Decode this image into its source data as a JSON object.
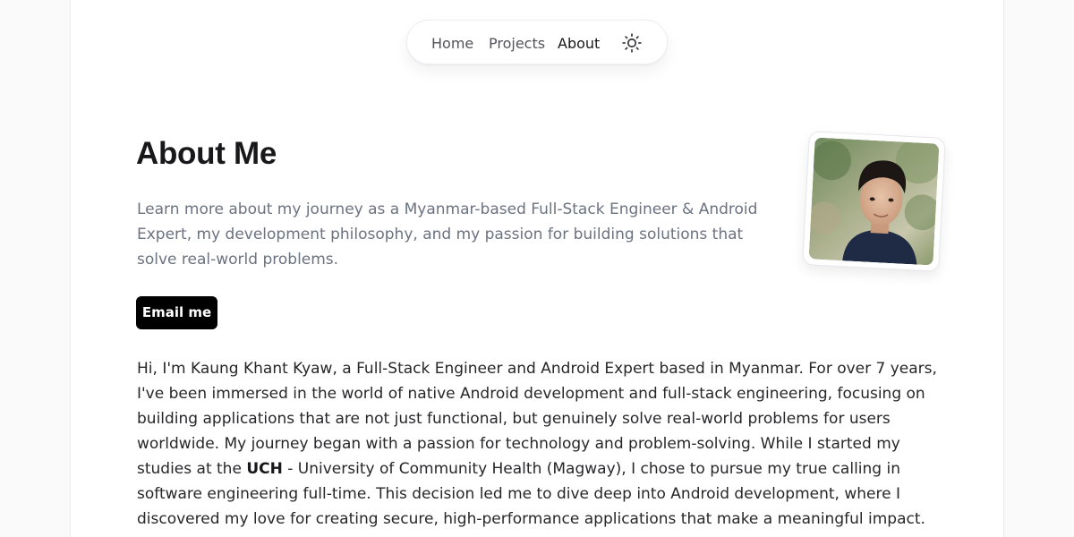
{
  "nav": {
    "links": [
      {
        "label": "Home",
        "active": false
      },
      {
        "label": "Projects",
        "active": false
      },
      {
        "label": "About",
        "active": true
      }
    ],
    "theme_toggle_icon": "sun-icon"
  },
  "hero": {
    "title": "About Me",
    "intro": "Learn more about my journey as a Myanmar-based Full-Stack Engineer & Android Expert, my development philosophy, and my passion for building solutions that solve real-world problems.",
    "email_button_label": "Email me",
    "avatar_icon": "profile-photo"
  },
  "bio": {
    "part1": "Hi, I'm Kaung Khant Kyaw, a Full-Stack Engineer and Android Expert based in Myanmar. For over 7 years, I've been immersed in the world of native Android development and full-stack engineering, focusing on building applications that are not just functional, but genuinely solve real-world problems for users worldwide. My journey began with a passion for technology and problem-solving. While I started my studies at the ",
    "highlight": "UCH",
    "part2": " - University of Community Health (Magway), I chose to pursue my true calling in software engineering full-time. This decision led me to dive deep into Android development, where I discovered my love for creating secure, high-performance applications that make a meaningful impact."
  },
  "colors": {
    "nav_text": "#52525b",
    "nav_active": "#18181b",
    "title": "#18181b",
    "intro_text": "#6b7280",
    "body_text": "#27272a",
    "button_bg": "#000000",
    "button_text": "#ffffff"
  }
}
